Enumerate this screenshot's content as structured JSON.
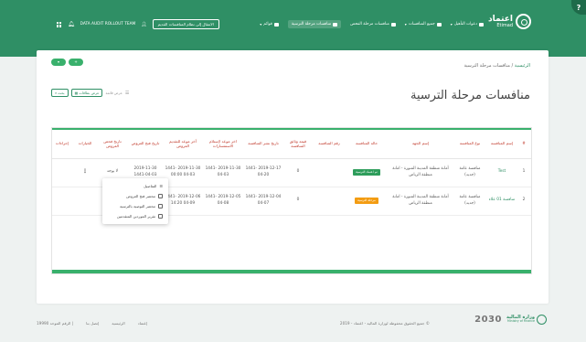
{
  "header": {
    "logo": {
      "ar": "اعتماد",
      "en": "Etimad"
    },
    "nav": [
      {
        "label": "دعوات التأهيل",
        "active": false,
        "caret": true
      },
      {
        "label": "جميع المنافسات",
        "active": false,
        "caret": true
      },
      {
        "label": "منافسات مرحلة الفحص",
        "active": false,
        "caret": false
      },
      {
        "label": "منافسات مرحلة الترسية",
        "active": true,
        "caret": false
      },
      {
        "label": "قوائم",
        "active": false,
        "caret": true
      }
    ],
    "switch_button": "الانتقال إلى نظام المنافسات القديم",
    "team_name": "DATA AUDIT ROLLOUT TEAM",
    "help_badge": "?"
  },
  "pills": [
    "▾",
    "+"
  ],
  "breadcrumb": {
    "home": "الرئيسية",
    "separator": "/",
    "current": "منافسات مرحلة الترسية"
  },
  "page_title": "منافسات مرحلة الترسية",
  "view_tools": {
    "list": "عرض قائمة",
    "cards": "عرض بطاقات",
    "search": "بحث"
  },
  "table": {
    "headers": [
      "#",
      "إسم المنافسة",
      "نوع المنافسة",
      "إسم الجهة",
      "حالة المنافسة",
      "رقم المنافسة",
      "قيمة وثائق المنافسة",
      "تاريخ نشر المنافسة",
      "اخر موعد لإستلام الاستفسارات",
      "آخر موعد للتقديم العروض",
      "تاريخ فتح العروض",
      "تاريخ فحص العروض",
      "الخيارات",
      "إجراءات"
    ],
    "rows": [
      {
        "num": "1",
        "name": "Test",
        "type": "منافسة عامة (جديد)",
        "agency": "أمانة منطقة المدينة المنورة - امانة منطقة الرياض",
        "status": "تم اعتماد الترسية",
        "status_color": "#2e9d5b",
        "ref": "",
        "doc_value": "0",
        "publish_date": "2019-12-17 1441-04-20",
        "inquiries_deadline": "2019-11-30 1441-04-03",
        "offers_deadline": "2019-11-30 1441-04-03 00:00",
        "open_date": "2019-11-30 1441-04-03",
        "examine_date": "لا يوجد",
        "options": "⋮",
        "actions": ""
      },
      {
        "num": "2",
        "name": "منافسة 01 علاء",
        "type": "منافسة عامة (جديد)",
        "agency": "أمانة منطقة المدينة المنورة - امانة منطقة الرياض",
        "status": "مرحلة الترسية",
        "status_color": "#f39c12",
        "ref": "",
        "doc_value": "0",
        "publish_date": "2019-12-04 1441-04-07",
        "inquiries_deadline": "2019-12-05 1441-04-08",
        "offers_deadline": "2019-12-06 1441-04-09 14:20",
        "open_date": "2019-12-04 1441-04-07",
        "examine_date": "",
        "options": "",
        "actions": ""
      }
    ]
  },
  "dropdown_menu": [
    "التفاصيل",
    "محضر فتح العروض",
    "محضر التوصية بالترسية",
    "تقرير الموردين المتقدمين"
  ],
  "footer": {
    "mof": {
      "ar": "وزارة المالية",
      "en": "Ministry of Finance"
    },
    "vision": "2030",
    "copyright": "© جميع الحقوق محفوظة لوزارة المالية - اعتماد - 2019",
    "links": [
      "إعتماد",
      "الرئيسية",
      "إتصل بنا",
      "| الرقم الموحد 19990"
    ]
  }
}
